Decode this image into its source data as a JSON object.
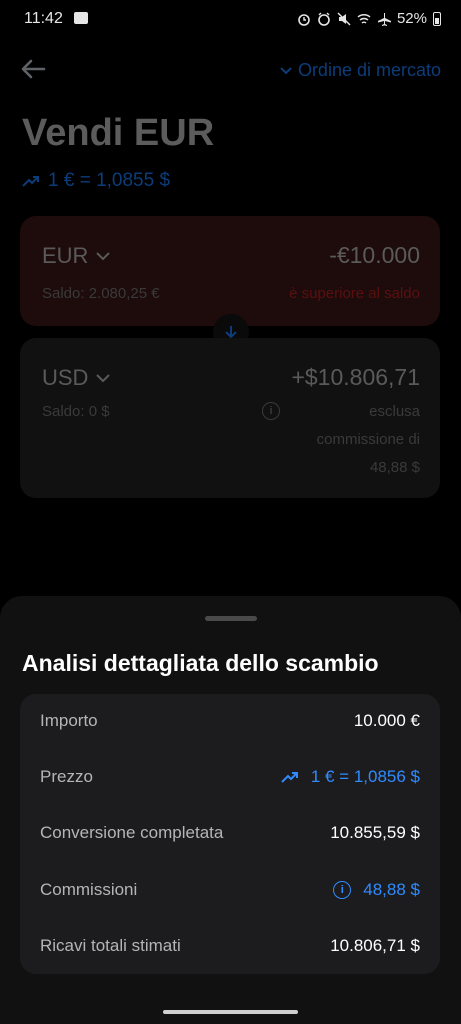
{
  "status": {
    "time": "11:42",
    "battery": "52%"
  },
  "header": {
    "order_type": "Ordine di mercato",
    "title": "Vendi EUR",
    "rate": "1 € = 1,0855 $"
  },
  "sell": {
    "currency": "EUR",
    "amount": "-€10.000",
    "balance": "Saldo: 2.080,25 €",
    "warning": "è superiore al saldo"
  },
  "buy": {
    "currency": "USD",
    "amount": "+$10.806,71",
    "balance": "Saldo: 0 $",
    "fee_line1": "esclusa",
    "fee_line2": "commissione di",
    "fee_line3": "48,88 $"
  },
  "sheet": {
    "title": "Analisi dettagliata dello scambio",
    "rows": [
      {
        "label": "Importo",
        "value": "10.000 €"
      },
      {
        "label": "Prezzo",
        "value": "1 € = 1,0856 $"
      },
      {
        "label": "Conversione completata",
        "value": "10.855,59 $"
      },
      {
        "label": "Commissioni",
        "value": "48,88 $"
      },
      {
        "label": "Ricavi totali stimati",
        "value": "10.806,71 $"
      }
    ]
  },
  "colors": {
    "accent_blue": "#2f8bff",
    "sheet_bg": "#111111",
    "panel_bg": "#1c1c1e"
  },
  "icons": [
    "back-arrow-icon",
    "chevron-down-icon",
    "trend-up-icon",
    "arrow-down-icon",
    "info-icon",
    "image-icon",
    "wifi-icon",
    "airplane-icon",
    "mute-icon",
    "alarm-icon",
    "battery-icon"
  ]
}
